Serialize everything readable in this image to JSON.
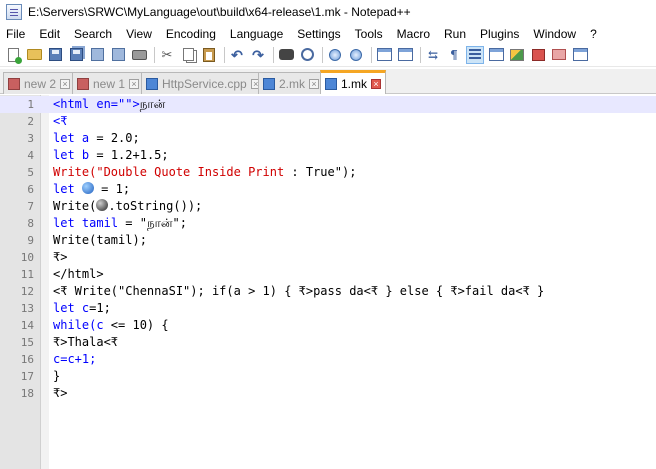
{
  "window": {
    "title": "E:\\Servers\\SRWC\\MyLanguage\\out\\build\\x64-release\\1.mk - Notepad++"
  },
  "menu": [
    "File",
    "Edit",
    "Search",
    "View",
    "Encoding",
    "Language",
    "Settings",
    "Tools",
    "Macro",
    "Run",
    "Plugins",
    "Window",
    "?"
  ],
  "toolbar_icons": [
    "new-file-icon",
    "open-file-icon",
    "save-icon",
    "save-all-icon",
    "close-icon",
    "close-all-icon",
    "print-icon",
    "cut-icon",
    "copy-icon",
    "paste-icon",
    "undo-icon",
    "redo-icon",
    "find-icon",
    "replace-icon",
    "zoom-in-icon",
    "zoom-out-icon",
    "sync-vertical-icon",
    "sync-horizontal-icon",
    "word-wrap-icon",
    "show-all-chars-icon",
    "indent-guide-icon",
    "language-udl-icon",
    "document-map-icon",
    "function-list-icon",
    "folder-workspace-icon",
    "monitoring-icon"
  ],
  "tabs": [
    {
      "label": "new 2",
      "active": false,
      "icon": "red"
    },
    {
      "label": "new 1",
      "active": false,
      "icon": "red"
    },
    {
      "label": "HttpService.cpp",
      "active": false,
      "icon": "blue"
    },
    {
      "label": "2.mk",
      "active": false,
      "icon": "blue"
    },
    {
      "label": "1.mk",
      "active": true,
      "icon": "blue"
    }
  ],
  "lines": [
    {
      "num": "1",
      "segments": [
        {
          "t": "<html en=\"\">",
          "c": "kw"
        },
        {
          "t": "நான்",
          "c": ""
        }
      ]
    },
    {
      "num": "2",
      "segments": [
        {
          "t": "<₹",
          "c": "kw"
        }
      ]
    },
    {
      "num": "3",
      "segments": [
        {
          "t": "let",
          "c": "kw"
        },
        {
          "t": " ",
          "c": ""
        },
        {
          "t": "a",
          "c": "kw"
        },
        {
          "t": " = 2.0;",
          "c": ""
        }
      ]
    },
    {
      "num": "4",
      "segments": [
        {
          "t": "let",
          "c": "kw"
        },
        {
          "t": " ",
          "c": ""
        },
        {
          "t": "b",
          "c": "kw"
        },
        {
          "t": " = 1.2+1.5;",
          "c": ""
        }
      ]
    },
    {
      "num": "5",
      "segments": [
        {
          "t": "Write(\"Double Quote Inside Print",
          "c": "str-red"
        },
        {
          "t": " : True\");",
          "c": ""
        }
      ]
    },
    {
      "num": "6",
      "segments": [
        {
          "t": "let",
          "c": "kw"
        },
        {
          "t": " ",
          "c": ""
        },
        {
          "t": "",
          "c": "globe"
        },
        {
          "t": " = 1;",
          "c": ""
        }
      ]
    },
    {
      "num": "7",
      "segments": [
        {
          "t": "Write(",
          "c": ""
        },
        {
          "t": "",
          "c": "globe-dark"
        },
        {
          "t": ".toString());",
          "c": ""
        }
      ]
    },
    {
      "num": "8",
      "segments": [
        {
          "t": "let",
          "c": "kw"
        },
        {
          "t": " ",
          "c": ""
        },
        {
          "t": "tamil",
          "c": "kw"
        },
        {
          "t": " = \"நான்\";",
          "c": ""
        }
      ]
    },
    {
      "num": "9",
      "segments": [
        {
          "t": "Write(tamil);",
          "c": ""
        }
      ]
    },
    {
      "num": "10",
      "segments": [
        {
          "t": "₹>",
          "c": ""
        }
      ]
    },
    {
      "num": "11",
      "segments": [
        {
          "t": "</html>",
          "c": ""
        }
      ]
    },
    {
      "num": "12",
      "segments": [
        {
          "t": "<₹ Write(\"ChennaSI\"); if(a > 1) { ₹>pass da<₹ } else { ₹>fail da<₹ }",
          "c": ""
        }
      ]
    },
    {
      "num": "13",
      "segments": [
        {
          "t": "let",
          "c": "kw"
        },
        {
          "t": " ",
          "c": ""
        },
        {
          "t": "c",
          "c": "kw"
        },
        {
          "t": "=1;",
          "c": ""
        }
      ]
    },
    {
      "num": "14",
      "segments": [
        {
          "t": "while(c",
          "c": "kw"
        },
        {
          "t": " <= 10) {",
          "c": ""
        }
      ]
    },
    {
      "num": "15",
      "segments": [
        {
          "t": "₹>Thala<₹",
          "c": ""
        }
      ]
    },
    {
      "num": "16",
      "segments": [
        {
          "t": "c=c+1;",
          "c": "kw"
        }
      ]
    },
    {
      "num": "17",
      "segments": [
        {
          "t": "}",
          "c": ""
        }
      ]
    },
    {
      "num": "18",
      "segments": [
        {
          "t": "₹>",
          "c": ""
        }
      ]
    }
  ],
  "current_line": 1,
  "colors": {
    "keyword": "#0000ff",
    "string": "#d00000",
    "current_line_bg": "#e8e8ff",
    "active_tab_accent": "#f5a623"
  }
}
